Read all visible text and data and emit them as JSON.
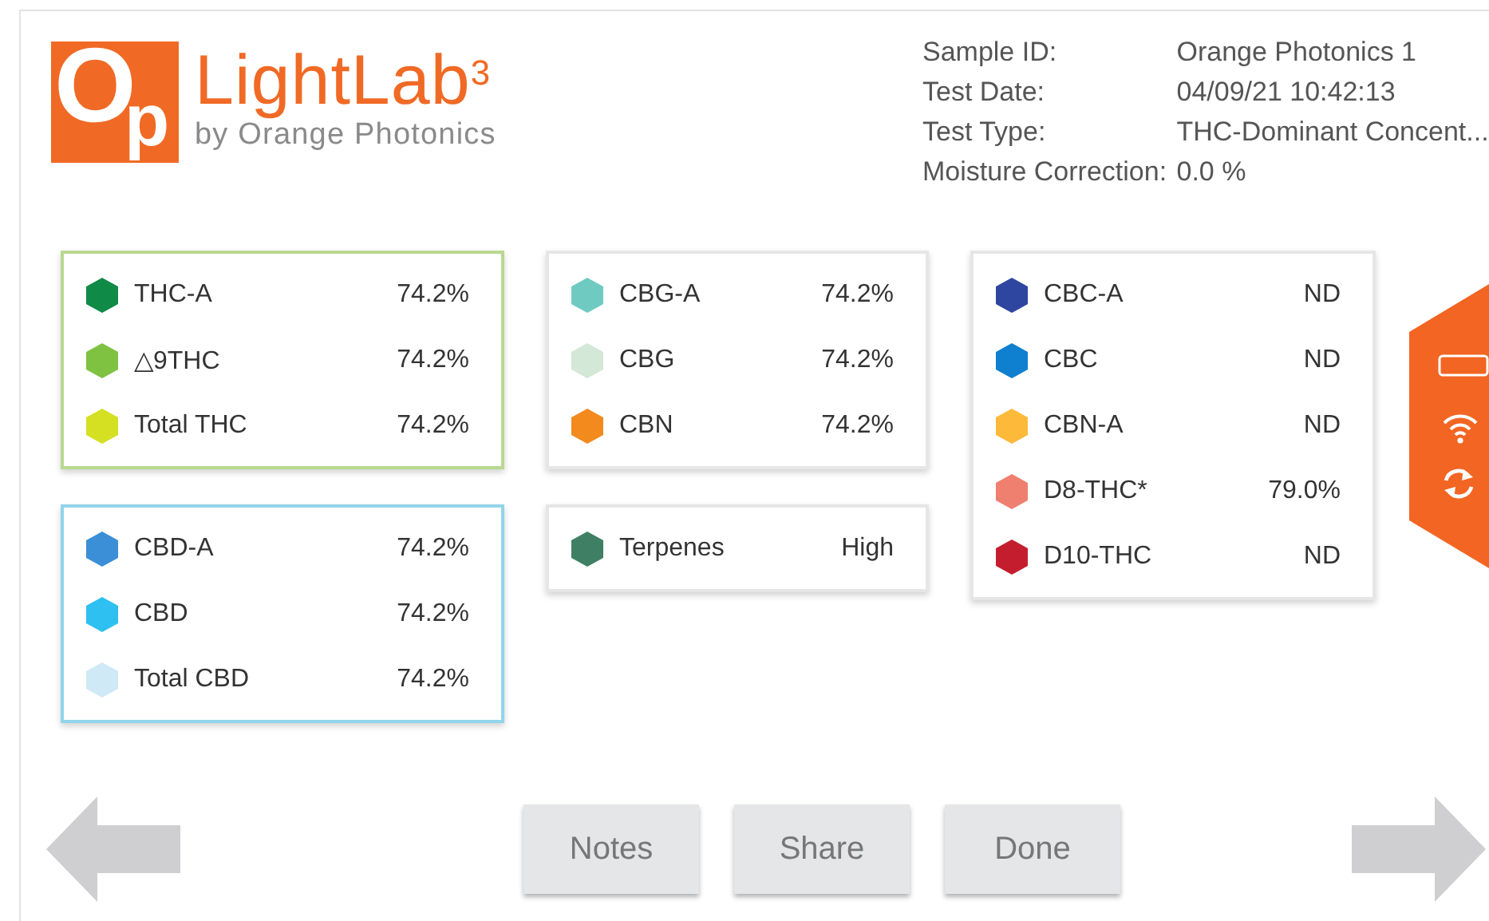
{
  "logo": {
    "mark_letters": [
      "O",
      "p"
    ],
    "name": "LightLab$^{3}$",
    "tagline": "by Orange Photonics"
  },
  "sample_info": [
    {
      "label": "Sample ID:",
      "value": "Orange Photonics 1"
    },
    {
      "label": "Test Date:",
      "value": "04/09/21 10:42:13"
    },
    {
      "label": "Test Type:",
      "value": "THC-Dominant Concent..."
    },
    {
      "label": "Moisture Correction:",
      "value": "0.0 %"
    }
  ],
  "columns": [
    [
      {
        "color": "#b9d98f",
        "items": [
          {
            "name": "THC-A",
            "value": "74.2%",
            "color": "#0f8a47"
          },
          {
            "name": "△9THC",
            "value": "74.2%",
            "color": "#7fc242"
          },
          {
            "name": "Total THC",
            "value": "74.2%",
            "color": "#d4e021"
          }
        ]
      },
      {
        "color": "#92d4ea",
        "items": [
          {
            "name": "CBD-A",
            "value": "74.2%",
            "color": "#3a8fd6"
          },
          {
            "name": "CBD",
            "value": "74.2%",
            "color": "#2ec0f0"
          },
          {
            "name": "Total CBD",
            "value": "74.2%",
            "color": "#cfe9f6"
          }
        ]
      }
    ],
    [
      {
        "color": "#e6e6e6",
        "items": [
          {
            "name": "CBG-A",
            "value": "74.2%",
            "color": "#6fcac2"
          },
          {
            "name": "CBG",
            "value": "74.2%",
            "color": "#d3e8d6"
          },
          {
            "name": "CBN",
            "value": "74.2%",
            "color": "#f28a1e"
          }
        ]
      },
      {
        "color": "#e6e6e6",
        "items": [
          {
            "name": "Terpenes",
            "value": "High",
            "color": "#3f8064"
          }
        ]
      }
    ],
    [
      {
        "color": "#e6e6e6",
        "items": [
          {
            "name": "CBC-A",
            "value": "ND",
            "color": "#2e46a0"
          },
          {
            "name": "CBC",
            "value": "ND",
            "color": "#0f7fd0"
          },
          {
            "name": "CBN-A",
            "value": "ND",
            "color": "#fdb93a"
          },
          {
            "name": "D8-THC*",
            "value": "79.0%",
            "color": "#ef8070"
          },
          {
            "name": "D10-THC",
            "value": "ND",
            "color": "#c41e2e"
          }
        ]
      }
    ]
  ],
  "buttons": [
    "Notes",
    "Share",
    "Done"
  ]
}
